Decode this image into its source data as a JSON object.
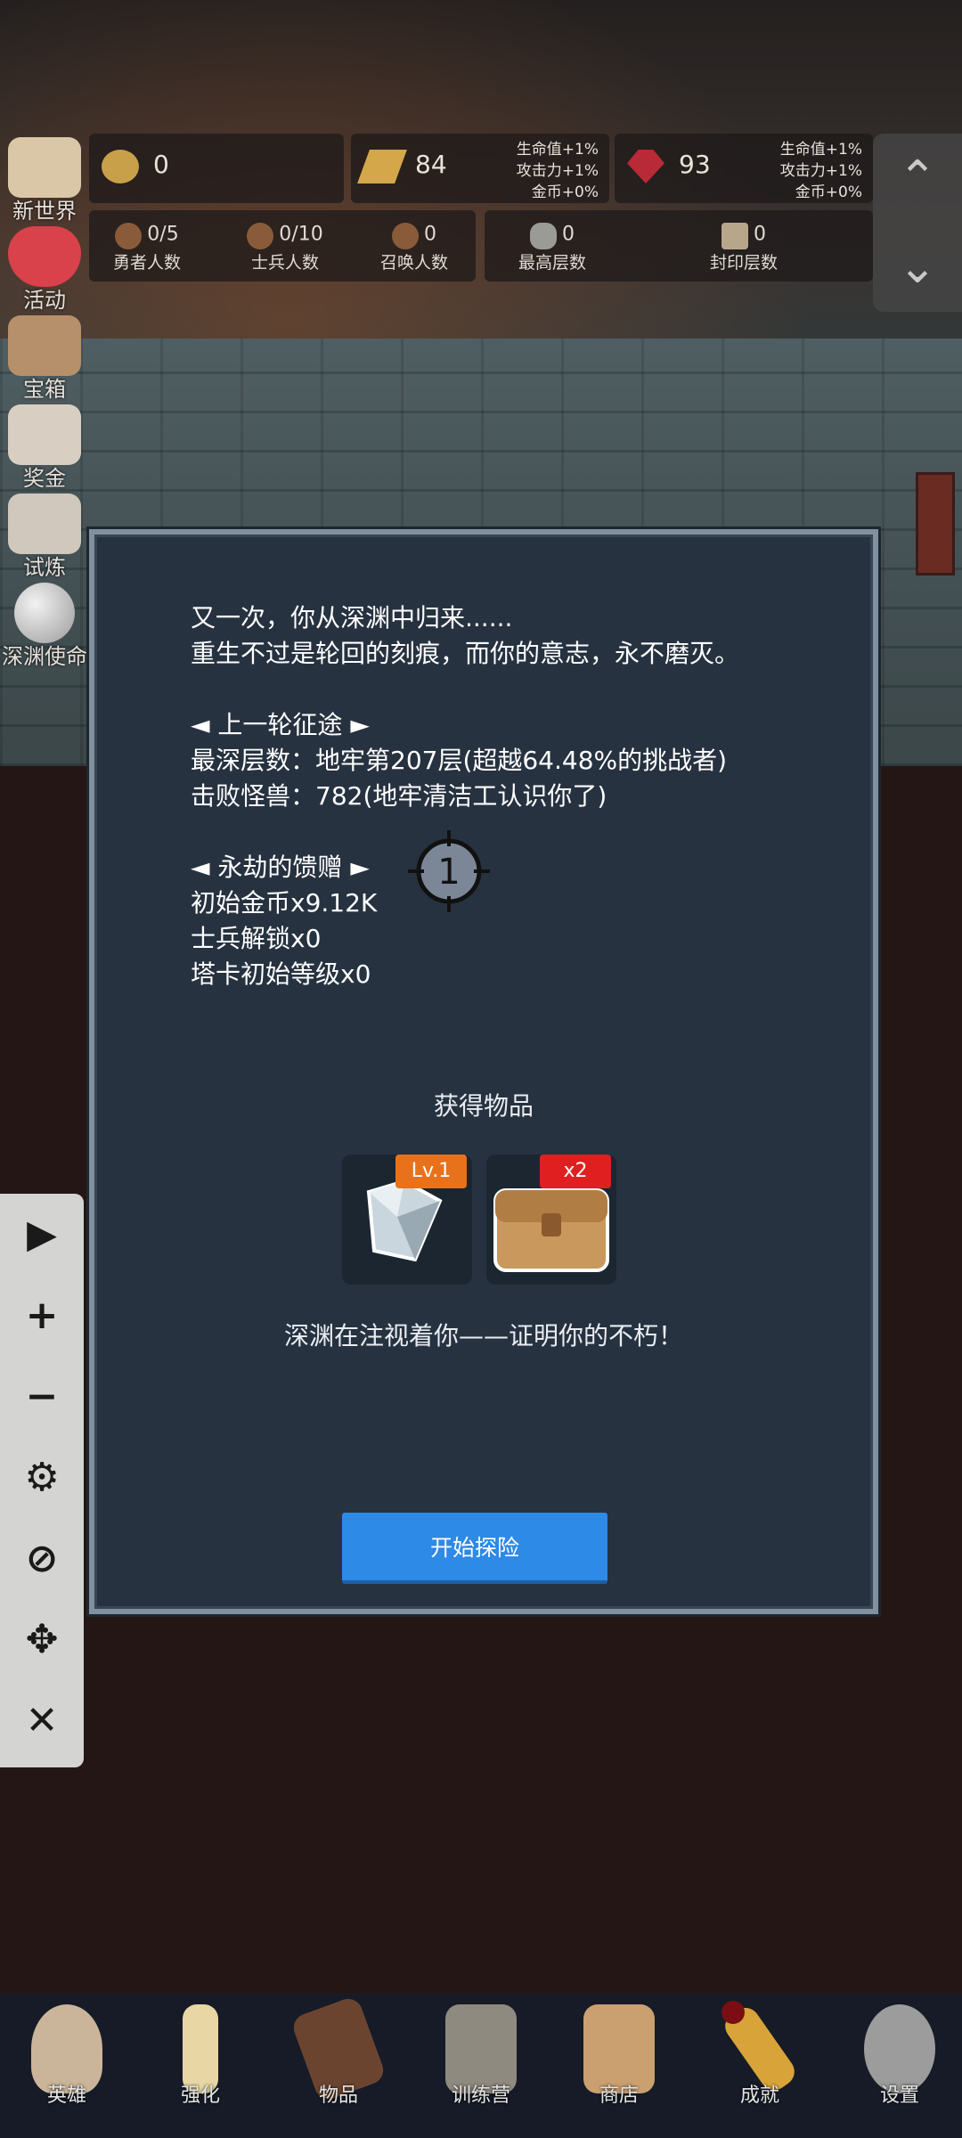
{
  "left_menu": [
    {
      "label": "新世界",
      "icon": "map-scroll-icon"
    },
    {
      "label": "活动",
      "icon": "heart-icon"
    },
    {
      "label": "宝箱",
      "icon": "chest-icon"
    },
    {
      "label": "奖金",
      "icon": "envelope-icon"
    },
    {
      "label": "试炼",
      "icon": "feather-icon"
    },
    {
      "label": "深渊使命",
      "icon": "orb-icon"
    }
  ],
  "resources": {
    "coins": {
      "value": "0",
      "icon": "coin-icon"
    },
    "gold": {
      "value": "84",
      "bonus": [
        "生命值+1%",
        "攻击力+1%",
        "金币+0%"
      ],
      "icon": "gold-bar-icon"
    },
    "gem": {
      "value": "93",
      "bonus": [
        "生命值+1%",
        "攻击力+1%",
        "金币+0%"
      ],
      "icon": "ruby-icon"
    }
  },
  "counts": {
    "heroes": {
      "value": "0/5",
      "label": "勇者人数"
    },
    "soldiers": {
      "value": "0/10",
      "label": "士兵人数"
    },
    "summons": {
      "value": "0",
      "label": "召唤人数"
    },
    "max_floor": {
      "value": "0",
      "label": "最高层数"
    },
    "sealed_floor": {
      "value": "0",
      "label": "封印层数"
    }
  },
  "scroll": {
    "up": "⌃",
    "down": "⌄"
  },
  "dialog": {
    "line1": "又一次，你从深渊中归来......",
    "line2": "重生不过是轮回的刻痕，而你的意志，永不磨灭。",
    "section1": "◄ 上一轮征途 ►",
    "deepest": "最深层数：地牢第207层(超越64.48%的挑战者)",
    "defeated": "击败怪兽：782(地牢清洁工认识你了)",
    "section2": "◄ 永劫的馈赠 ►",
    "gift1": "初始金币x9.12K",
    "gift2": "士兵解锁x0",
    "gift3": "塔卡初始等级x0",
    "target_number": "1",
    "items_title": "获得物品",
    "items": [
      {
        "name": "diamond-item",
        "tag": "Lv.1",
        "tag_color": "#e8721c"
      },
      {
        "name": "chest-item",
        "tag": "x2",
        "tag_color": "#e02020"
      }
    ],
    "footer": "深渊在注视着你——证明你的不朽！",
    "start_button": "开始探险"
  },
  "toolbar": [
    {
      "name": "play-icon",
      "glyph": "▶"
    },
    {
      "name": "plus-icon",
      "glyph": "+"
    },
    {
      "name": "minus-icon",
      "glyph": "−"
    },
    {
      "name": "gear-icon",
      "glyph": "⚙"
    },
    {
      "name": "eye-hidden-icon",
      "glyph": "⊘"
    },
    {
      "name": "move-icon",
      "glyph": "✥"
    },
    {
      "name": "close-icon",
      "glyph": "✕"
    }
  ],
  "bottom_nav": [
    {
      "label": "英雄",
      "icon": "skull-icon"
    },
    {
      "label": "强化",
      "icon": "candle-icon"
    },
    {
      "label": "物品",
      "icon": "book-icon"
    },
    {
      "label": "训练营",
      "icon": "lantern-icon"
    },
    {
      "label": "商店",
      "icon": "mug-icon"
    },
    {
      "label": "成就",
      "icon": "key-icon"
    },
    {
      "label": "设置",
      "icon": "settings-gear-icon"
    }
  ]
}
